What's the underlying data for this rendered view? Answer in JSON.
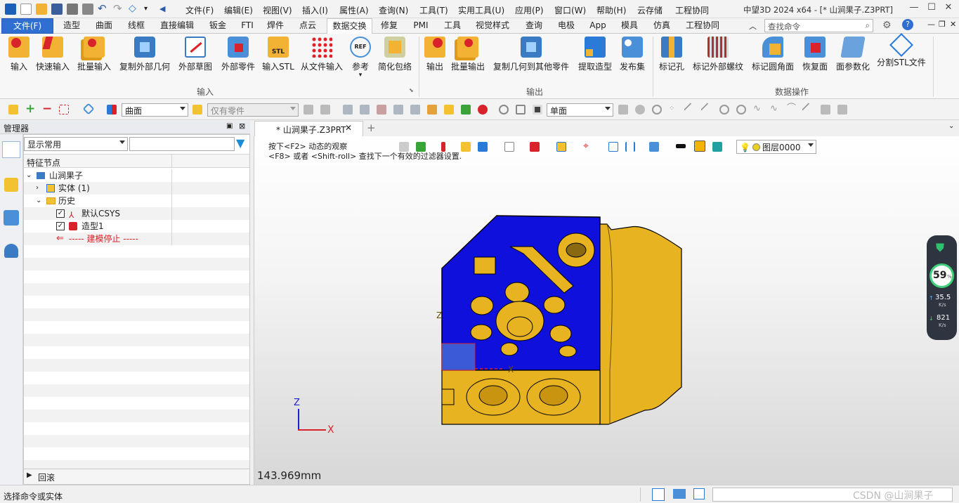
{
  "window": {
    "title": "中望3D 2024 x64 - [* 山涧果子.Z3PRT]"
  },
  "menubar": {
    "items": [
      "文件(F)",
      "编辑(E)",
      "视图(V)",
      "插入(I)",
      "属性(A)",
      "查询(N)",
      "工具(T)",
      "实用工具(U)",
      "应用(P)",
      "窗口(W)",
      "帮助(H)",
      "云存储",
      "工程协同"
    ]
  },
  "ribbon_tabs": {
    "file": "文件(F)",
    "items": [
      "造型",
      "曲面",
      "线框",
      "直接编辑",
      "钣金",
      "FTI",
      "焊件",
      "点云",
      "数据交换",
      "修复",
      "PMI",
      "工具",
      "视觉样式",
      "查询",
      "电极",
      "App",
      "模具",
      "仿真",
      "工程协同"
    ],
    "active": "数据交换"
  },
  "search": {
    "placeholder": "查找命令"
  },
  "ribbon": {
    "input_buttons": [
      "输入",
      "快速输入",
      "批量输入",
      "复制外部几何",
      "外部草图",
      "外部零件",
      "输入STL",
      "从文件输入",
      "参考",
      "简化包络"
    ],
    "output_buttons": [
      "输出",
      "批量输出",
      "复制几何到其他零件",
      "提取造型",
      "发布集"
    ],
    "data_buttons": [
      "标记孔",
      "标记外部螺纹",
      "标记圆角面",
      "恢复面",
      "面参数化",
      "分割STL文件"
    ],
    "groups": {
      "input": "输入",
      "output": "输出",
      "data": "数据操作"
    }
  },
  "toolbar": {
    "filter_mode": "曲面",
    "scope": "仅有零件",
    "face_mode": "单面"
  },
  "manager": {
    "title": "管理器",
    "display_filter": "显示常用",
    "column_header": "特征节点",
    "tree": {
      "root": "山涧果子",
      "solid": "实体 (1)",
      "history": "历史",
      "csys": "默认CSYS",
      "model": "造型1",
      "stop": "----- 建模停止 -----"
    },
    "footer": "回滚"
  },
  "document": {
    "tab_label": "* 山涧果子.Z3PRT"
  },
  "viewport": {
    "hint_line1": "按下<F2> 动态的观察",
    "hint_line2": "<F8> 或者 <Shift-roll> 查找下一个有效的过滤器设置.",
    "layer": "图层0000",
    "scale": "143.969mm",
    "axis_x": "X",
    "axis_z": "Z"
  },
  "monitor": {
    "percent": "59",
    "percent_unit": "%",
    "up_speed": "35.5",
    "down_speed": "821",
    "unit": "K/s"
  },
  "status": {
    "prompt": "选择命令或实体",
    "watermark": "CSDN @山涧果子"
  },
  "colors": {
    "accent": "#2f6fd2",
    "model_blue": "#1010dd",
    "model_gold": "#e8b321"
  }
}
